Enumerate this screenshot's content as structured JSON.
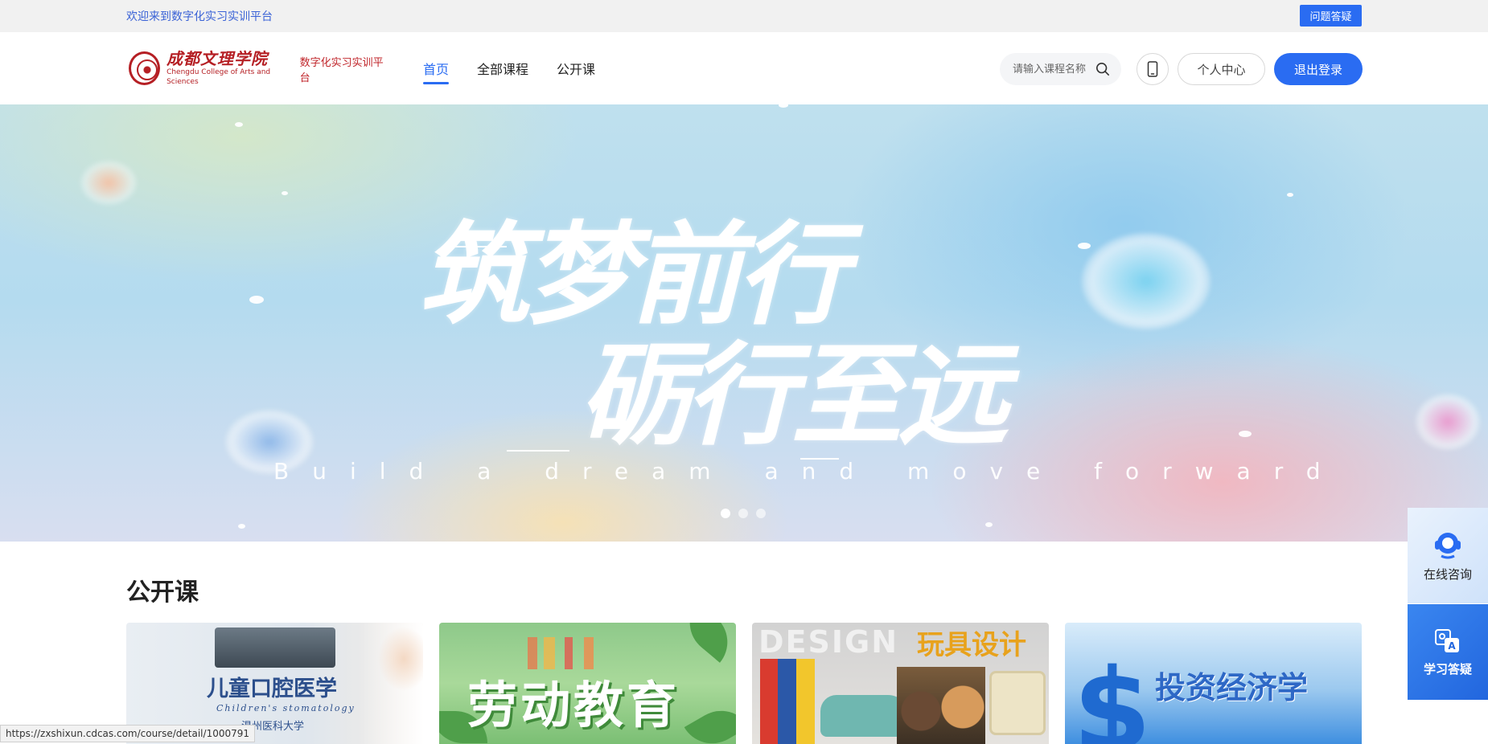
{
  "topbar": {
    "welcome": "欢迎来到数字化实习实训平台",
    "qa_button": "问题答疑"
  },
  "header": {
    "logo": {
      "cn": "成都文理学院",
      "en": "Chengdu College of Arts and Sciences",
      "platform": "数字化实习实训平台"
    },
    "nav": [
      {
        "label": "首页",
        "active": true
      },
      {
        "label": "全部课程",
        "active": false
      },
      {
        "label": "公开课",
        "active": false
      }
    ],
    "search": {
      "placeholder": "请输入课程名称"
    },
    "personal_center": "个人中心",
    "logout": "退出登录"
  },
  "banner": {
    "slogan_line1": "筑梦前行",
    "slogan_line2": "砺行至远",
    "slogan_en": "Build a dream and move forward",
    "slides": 3,
    "active_slide": 0
  },
  "section": {
    "title": "公开课",
    "courses": [
      {
        "title": "儿童口腔医学",
        "subtitle": "Children's stomatology",
        "school": "温州医科大学"
      },
      {
        "title": "劳动教育"
      },
      {
        "title": "玩具设计",
        "watermark": "DESIGN"
      },
      {
        "title": "投资经济学",
        "symbol": "$"
      }
    ]
  },
  "side_panel": {
    "consult": "在线咨询",
    "study_qa": "学习答疑"
  },
  "statusbar": {
    "url": "https://zxshixun.cdcas.com/course/detail/1000791"
  },
  "colors": {
    "primary": "#2a6cf2",
    "brand_red": "#b51f24"
  }
}
